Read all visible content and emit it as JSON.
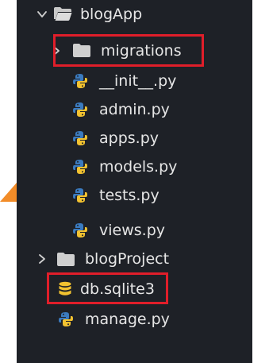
{
  "explorer": {
    "root": {
      "label": "blogApp",
      "expanded": true
    },
    "items": [
      {
        "label": "migrations",
        "type": "folder",
        "expanded": false,
        "highlighted": true
      },
      {
        "label": "__init__.py",
        "type": "python-file"
      },
      {
        "label": "admin.py",
        "type": "python-file"
      },
      {
        "label": "apps.py",
        "type": "python-file"
      },
      {
        "label": "models.py",
        "type": "python-file"
      },
      {
        "label": "tests.py",
        "type": "python-file"
      },
      {
        "label": "views.py",
        "type": "python-file"
      }
    ],
    "siblings": [
      {
        "label": "blogProject",
        "type": "folder",
        "expanded": false
      },
      {
        "label": "db.sqlite3",
        "type": "database-file",
        "highlighted": true
      },
      {
        "label": "manage.py",
        "type": "python-file"
      }
    ]
  },
  "colors": {
    "panel_background": "#1e2127",
    "text": "#e6e6e6",
    "highlight_border": "#e01e2a",
    "python_blue": "#3b7bbf",
    "python_yellow": "#f2c230",
    "database_icon": "#f2c230",
    "arrow_accent": "#f28c28"
  },
  "icons": {
    "folder": "folder-icon",
    "python": "python-icon",
    "database": "database-icon",
    "chevron_expanded": "chevron-down-icon",
    "chevron_collapsed": "chevron-right-icon"
  }
}
